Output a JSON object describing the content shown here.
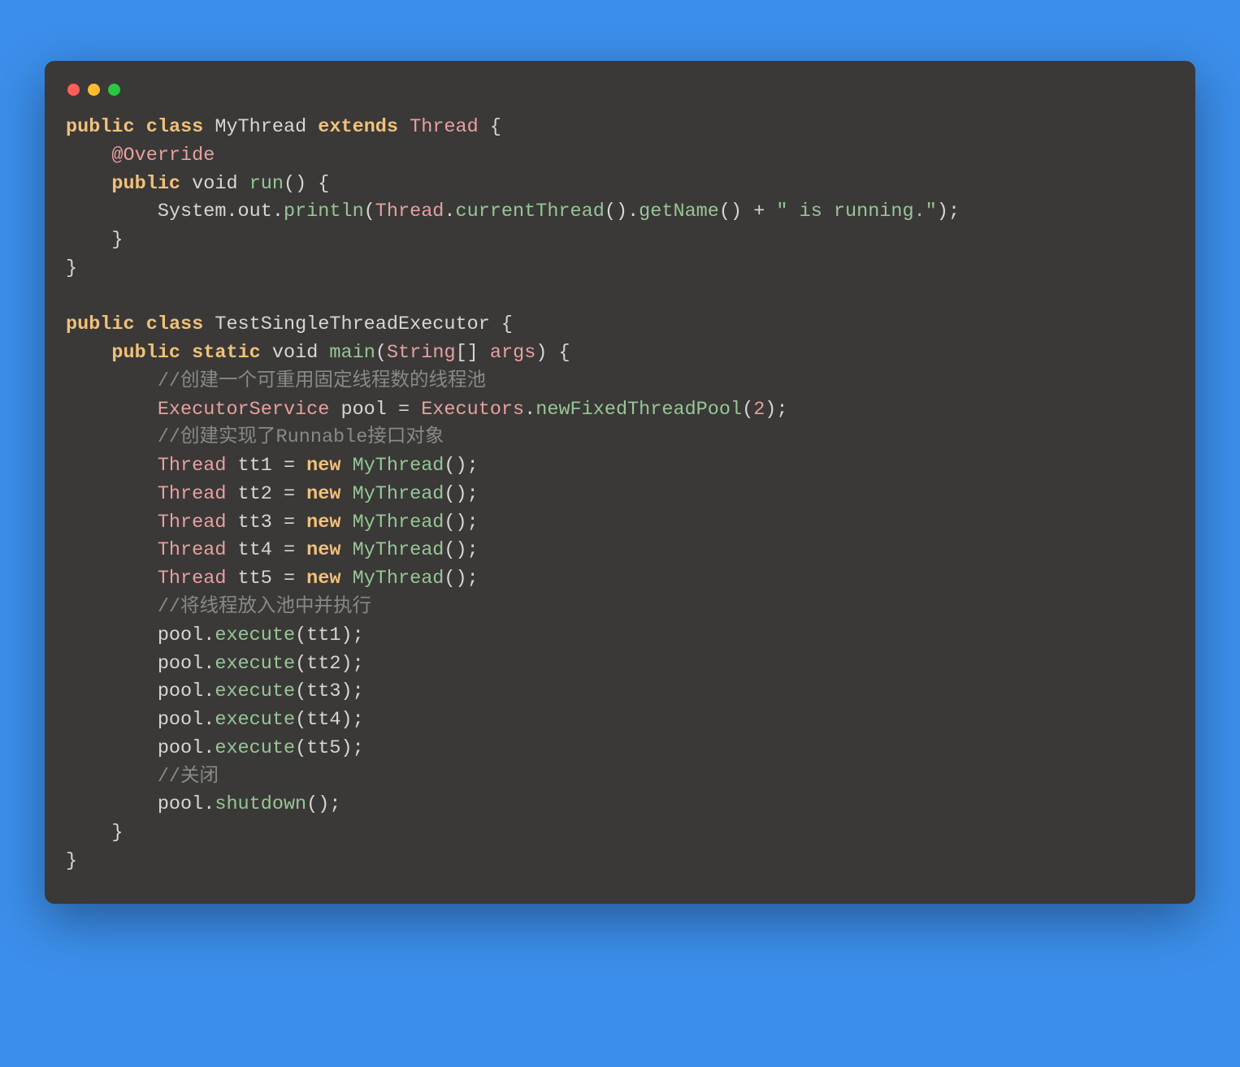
{
  "code": {
    "tokens": [
      [
        [
          "kw",
          "public"
        ],
        [
          "sp",
          " "
        ],
        [
          "kw",
          "class"
        ],
        [
          "sp",
          " "
        ],
        [
          "pl",
          "MyThread"
        ],
        [
          "sp",
          " "
        ],
        [
          "kw",
          "extends"
        ],
        [
          "sp",
          " "
        ],
        [
          "typ",
          "Thread"
        ],
        [
          "sp",
          " "
        ],
        [
          "pl",
          "{"
        ]
      ],
      [
        [
          "sp",
          "    "
        ],
        [
          "ann",
          "@Override"
        ]
      ],
      [
        [
          "sp",
          "    "
        ],
        [
          "kw",
          "public"
        ],
        [
          "sp",
          " "
        ],
        [
          "void",
          "void"
        ],
        [
          "sp",
          " "
        ],
        [
          "fn",
          "run"
        ],
        [
          "pl",
          "()"
        ],
        [
          "sp",
          " "
        ],
        [
          "pl",
          "{"
        ]
      ],
      [
        [
          "sp",
          "        "
        ],
        [
          "pl",
          "System.out."
        ],
        [
          "fn",
          "println"
        ],
        [
          "pl",
          "("
        ],
        [
          "typ",
          "Thread"
        ],
        [
          "pl",
          "."
        ],
        [
          "fn",
          "currentThread"
        ],
        [
          "pl",
          "()."
        ],
        [
          "fn",
          "getName"
        ],
        [
          "pl",
          "()"
        ],
        [
          "sp",
          " "
        ],
        [
          "pl",
          "+"
        ],
        [
          "sp",
          " "
        ],
        [
          "str",
          "\" is running.\""
        ],
        [
          "pl",
          ");"
        ]
      ],
      [
        [
          "sp",
          "    "
        ],
        [
          "pl",
          "}"
        ]
      ],
      [
        [
          "pl",
          "}"
        ]
      ],
      [],
      [
        [
          "kw",
          "public"
        ],
        [
          "sp",
          " "
        ],
        [
          "kw",
          "class"
        ],
        [
          "sp",
          " "
        ],
        [
          "pl",
          "TestSingleThreadExecutor"
        ],
        [
          "sp",
          " "
        ],
        [
          "pl",
          "{"
        ]
      ],
      [
        [
          "sp",
          "    "
        ],
        [
          "kw",
          "public"
        ],
        [
          "sp",
          " "
        ],
        [
          "kw",
          "static"
        ],
        [
          "sp",
          " "
        ],
        [
          "void",
          "void"
        ],
        [
          "sp",
          " "
        ],
        [
          "fn",
          "main"
        ],
        [
          "pl",
          "("
        ],
        [
          "typ",
          "String"
        ],
        [
          "pl",
          "[]"
        ],
        [
          "sp",
          " "
        ],
        [
          "arg",
          "args"
        ],
        [
          "pl",
          ")"
        ],
        [
          "sp",
          " "
        ],
        [
          "pl",
          "{"
        ]
      ],
      [
        [
          "sp",
          "        "
        ],
        [
          "com",
          "//创建一个可重用固定线程数的线程池"
        ]
      ],
      [
        [
          "sp",
          "        "
        ],
        [
          "typ",
          "ExecutorService"
        ],
        [
          "sp",
          " "
        ],
        [
          "pl",
          "pool"
        ],
        [
          "sp",
          " "
        ],
        [
          "pl",
          "="
        ],
        [
          "sp",
          " "
        ],
        [
          "typ",
          "Executors"
        ],
        [
          "pl",
          "."
        ],
        [
          "fn",
          "newFixedThreadPool"
        ],
        [
          "pl",
          "("
        ],
        [
          "num",
          "2"
        ],
        [
          "pl",
          ");"
        ]
      ],
      [
        [
          "sp",
          "        "
        ],
        [
          "com",
          "//创建实现了Runnable接口对象"
        ]
      ],
      [
        [
          "sp",
          "        "
        ],
        [
          "typ",
          "Thread"
        ],
        [
          "sp",
          " "
        ],
        [
          "pl",
          "tt1"
        ],
        [
          "sp",
          " "
        ],
        [
          "pl",
          "="
        ],
        [
          "sp",
          " "
        ],
        [
          "kw",
          "new"
        ],
        [
          "sp",
          " "
        ],
        [
          "fn",
          "MyThread"
        ],
        [
          "pl",
          "();"
        ]
      ],
      [
        [
          "sp",
          "        "
        ],
        [
          "typ",
          "Thread"
        ],
        [
          "sp",
          " "
        ],
        [
          "pl",
          "tt2"
        ],
        [
          "sp",
          " "
        ],
        [
          "pl",
          "="
        ],
        [
          "sp",
          " "
        ],
        [
          "kw",
          "new"
        ],
        [
          "sp",
          " "
        ],
        [
          "fn",
          "MyThread"
        ],
        [
          "pl",
          "();"
        ]
      ],
      [
        [
          "sp",
          "        "
        ],
        [
          "typ",
          "Thread"
        ],
        [
          "sp",
          " "
        ],
        [
          "pl",
          "tt3"
        ],
        [
          "sp",
          " "
        ],
        [
          "pl",
          "="
        ],
        [
          "sp",
          " "
        ],
        [
          "kw",
          "new"
        ],
        [
          "sp",
          " "
        ],
        [
          "fn",
          "MyThread"
        ],
        [
          "pl",
          "();"
        ]
      ],
      [
        [
          "sp",
          "        "
        ],
        [
          "typ",
          "Thread"
        ],
        [
          "sp",
          " "
        ],
        [
          "pl",
          "tt4"
        ],
        [
          "sp",
          " "
        ],
        [
          "pl",
          "="
        ],
        [
          "sp",
          " "
        ],
        [
          "kw",
          "new"
        ],
        [
          "sp",
          " "
        ],
        [
          "fn",
          "MyThread"
        ],
        [
          "pl",
          "();"
        ]
      ],
      [
        [
          "sp",
          "        "
        ],
        [
          "typ",
          "Thread"
        ],
        [
          "sp",
          " "
        ],
        [
          "pl",
          "tt5"
        ],
        [
          "sp",
          " "
        ],
        [
          "pl",
          "="
        ],
        [
          "sp",
          " "
        ],
        [
          "kw",
          "new"
        ],
        [
          "sp",
          " "
        ],
        [
          "fn",
          "MyThread"
        ],
        [
          "pl",
          "();"
        ]
      ],
      [
        [
          "sp",
          "        "
        ],
        [
          "com",
          "//将线程放入池中并执行"
        ]
      ],
      [
        [
          "sp",
          "        "
        ],
        [
          "pl",
          "pool."
        ],
        [
          "fn",
          "execute"
        ],
        [
          "pl",
          "(tt1);"
        ]
      ],
      [
        [
          "sp",
          "        "
        ],
        [
          "pl",
          "pool."
        ],
        [
          "fn",
          "execute"
        ],
        [
          "pl",
          "(tt2);"
        ]
      ],
      [
        [
          "sp",
          "        "
        ],
        [
          "pl",
          "pool."
        ],
        [
          "fn",
          "execute"
        ],
        [
          "pl",
          "(tt3);"
        ]
      ],
      [
        [
          "sp",
          "        "
        ],
        [
          "pl",
          "pool."
        ],
        [
          "fn",
          "execute"
        ],
        [
          "pl",
          "(tt4);"
        ]
      ],
      [
        [
          "sp",
          "        "
        ],
        [
          "pl",
          "pool."
        ],
        [
          "fn",
          "execute"
        ],
        [
          "pl",
          "(tt5);"
        ]
      ],
      [
        [
          "sp",
          "        "
        ],
        [
          "com",
          "//关闭"
        ]
      ],
      [
        [
          "sp",
          "        "
        ],
        [
          "pl",
          "pool."
        ],
        [
          "fn",
          "shutdown"
        ],
        [
          "pl",
          "();"
        ]
      ],
      [
        [
          "sp",
          "    "
        ],
        [
          "pl",
          "}"
        ]
      ],
      [
        [
          "pl",
          "}"
        ]
      ]
    ]
  }
}
